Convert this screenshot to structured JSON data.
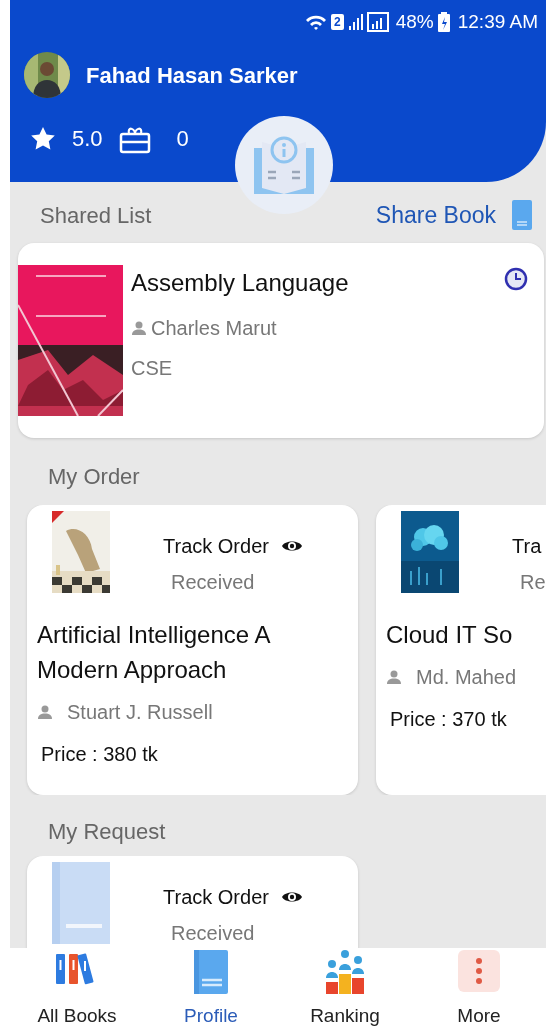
{
  "status_bar": {
    "sim_slot": "2",
    "battery": "48%",
    "time": "12:39 AM"
  },
  "profile": {
    "name": "Fahad Hasan Sarker",
    "rating": "5.0",
    "gifts": "0"
  },
  "shared_list": {
    "title": "Shared List",
    "action": "Share Book",
    "items": [
      {
        "title": "Assembly Language",
        "author": "Charles Marut",
        "department": "CSE"
      }
    ]
  },
  "my_order": {
    "title": "My Order",
    "items": [
      {
        "track_label": "Track Order",
        "eye": true,
        "status": "Received",
        "title": "Artificial Intelligence A Modern Approach",
        "author": "Stuart J. Russell",
        "price": "Price : 380 tk"
      },
      {
        "track_label": "Tra",
        "eye": false,
        "status": "Re",
        "title": "Cloud IT So",
        "author": "Md. Mahed",
        "price": "Price : 370 tk"
      }
    ]
  },
  "my_request": {
    "title": "My Request",
    "items": [
      {
        "track_label": "Track Order",
        "eye": true,
        "status": "Received"
      }
    ]
  },
  "bottom_nav": [
    {
      "kind": "books",
      "label": "All Books",
      "selected": false
    },
    {
      "kind": "profile",
      "label": "Profile",
      "selected": true
    },
    {
      "kind": "ranking",
      "label": "Ranking",
      "selected": false
    },
    {
      "kind": "more",
      "label": "More",
      "selected": false
    }
  ]
}
